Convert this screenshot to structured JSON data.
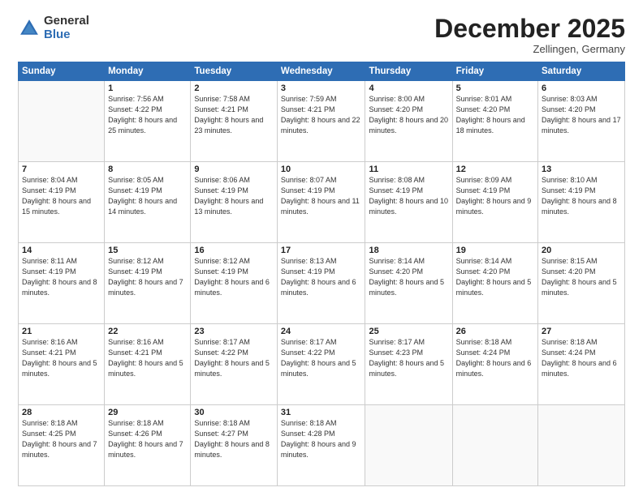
{
  "logo": {
    "general": "General",
    "blue": "Blue"
  },
  "header": {
    "month": "December 2025",
    "location": "Zellingen, Germany"
  },
  "weekdays": [
    "Sunday",
    "Monday",
    "Tuesday",
    "Wednesday",
    "Thursday",
    "Friday",
    "Saturday"
  ],
  "weeks": [
    [
      {
        "day": "",
        "sunrise": "",
        "sunset": "",
        "daylight": ""
      },
      {
        "day": "1",
        "sunrise": "Sunrise: 7:56 AM",
        "sunset": "Sunset: 4:22 PM",
        "daylight": "Daylight: 8 hours and 25 minutes."
      },
      {
        "day": "2",
        "sunrise": "Sunrise: 7:58 AM",
        "sunset": "Sunset: 4:21 PM",
        "daylight": "Daylight: 8 hours and 23 minutes."
      },
      {
        "day": "3",
        "sunrise": "Sunrise: 7:59 AM",
        "sunset": "Sunset: 4:21 PM",
        "daylight": "Daylight: 8 hours and 22 minutes."
      },
      {
        "day": "4",
        "sunrise": "Sunrise: 8:00 AM",
        "sunset": "Sunset: 4:20 PM",
        "daylight": "Daylight: 8 hours and 20 minutes."
      },
      {
        "day": "5",
        "sunrise": "Sunrise: 8:01 AM",
        "sunset": "Sunset: 4:20 PM",
        "daylight": "Daylight: 8 hours and 18 minutes."
      },
      {
        "day": "6",
        "sunrise": "Sunrise: 8:03 AM",
        "sunset": "Sunset: 4:20 PM",
        "daylight": "Daylight: 8 hours and 17 minutes."
      }
    ],
    [
      {
        "day": "7",
        "sunrise": "Sunrise: 8:04 AM",
        "sunset": "Sunset: 4:19 PM",
        "daylight": "Daylight: 8 hours and 15 minutes."
      },
      {
        "day": "8",
        "sunrise": "Sunrise: 8:05 AM",
        "sunset": "Sunset: 4:19 PM",
        "daylight": "Daylight: 8 hours and 14 minutes."
      },
      {
        "day": "9",
        "sunrise": "Sunrise: 8:06 AM",
        "sunset": "Sunset: 4:19 PM",
        "daylight": "Daylight: 8 hours and 13 minutes."
      },
      {
        "day": "10",
        "sunrise": "Sunrise: 8:07 AM",
        "sunset": "Sunset: 4:19 PM",
        "daylight": "Daylight: 8 hours and 11 minutes."
      },
      {
        "day": "11",
        "sunrise": "Sunrise: 8:08 AM",
        "sunset": "Sunset: 4:19 PM",
        "daylight": "Daylight: 8 hours and 10 minutes."
      },
      {
        "day": "12",
        "sunrise": "Sunrise: 8:09 AM",
        "sunset": "Sunset: 4:19 PM",
        "daylight": "Daylight: 8 hours and 9 minutes."
      },
      {
        "day": "13",
        "sunrise": "Sunrise: 8:10 AM",
        "sunset": "Sunset: 4:19 PM",
        "daylight": "Daylight: 8 hours and 8 minutes."
      }
    ],
    [
      {
        "day": "14",
        "sunrise": "Sunrise: 8:11 AM",
        "sunset": "Sunset: 4:19 PM",
        "daylight": "Daylight: 8 hours and 8 minutes."
      },
      {
        "day": "15",
        "sunrise": "Sunrise: 8:12 AM",
        "sunset": "Sunset: 4:19 PM",
        "daylight": "Daylight: 8 hours and 7 minutes."
      },
      {
        "day": "16",
        "sunrise": "Sunrise: 8:12 AM",
        "sunset": "Sunset: 4:19 PM",
        "daylight": "Daylight: 8 hours and 6 minutes."
      },
      {
        "day": "17",
        "sunrise": "Sunrise: 8:13 AM",
        "sunset": "Sunset: 4:19 PM",
        "daylight": "Daylight: 8 hours and 6 minutes."
      },
      {
        "day": "18",
        "sunrise": "Sunrise: 8:14 AM",
        "sunset": "Sunset: 4:20 PM",
        "daylight": "Daylight: 8 hours and 5 minutes."
      },
      {
        "day": "19",
        "sunrise": "Sunrise: 8:14 AM",
        "sunset": "Sunset: 4:20 PM",
        "daylight": "Daylight: 8 hours and 5 minutes."
      },
      {
        "day": "20",
        "sunrise": "Sunrise: 8:15 AM",
        "sunset": "Sunset: 4:20 PM",
        "daylight": "Daylight: 8 hours and 5 minutes."
      }
    ],
    [
      {
        "day": "21",
        "sunrise": "Sunrise: 8:16 AM",
        "sunset": "Sunset: 4:21 PM",
        "daylight": "Daylight: 8 hours and 5 minutes."
      },
      {
        "day": "22",
        "sunrise": "Sunrise: 8:16 AM",
        "sunset": "Sunset: 4:21 PM",
        "daylight": "Daylight: 8 hours and 5 minutes."
      },
      {
        "day": "23",
        "sunrise": "Sunrise: 8:17 AM",
        "sunset": "Sunset: 4:22 PM",
        "daylight": "Daylight: 8 hours and 5 minutes."
      },
      {
        "day": "24",
        "sunrise": "Sunrise: 8:17 AM",
        "sunset": "Sunset: 4:22 PM",
        "daylight": "Daylight: 8 hours and 5 minutes."
      },
      {
        "day": "25",
        "sunrise": "Sunrise: 8:17 AM",
        "sunset": "Sunset: 4:23 PM",
        "daylight": "Daylight: 8 hours and 5 minutes."
      },
      {
        "day": "26",
        "sunrise": "Sunrise: 8:18 AM",
        "sunset": "Sunset: 4:24 PM",
        "daylight": "Daylight: 8 hours and 6 minutes."
      },
      {
        "day": "27",
        "sunrise": "Sunrise: 8:18 AM",
        "sunset": "Sunset: 4:24 PM",
        "daylight": "Daylight: 8 hours and 6 minutes."
      }
    ],
    [
      {
        "day": "28",
        "sunrise": "Sunrise: 8:18 AM",
        "sunset": "Sunset: 4:25 PM",
        "daylight": "Daylight: 8 hours and 7 minutes."
      },
      {
        "day": "29",
        "sunrise": "Sunrise: 8:18 AM",
        "sunset": "Sunset: 4:26 PM",
        "daylight": "Daylight: 8 hours and 7 minutes."
      },
      {
        "day": "30",
        "sunrise": "Sunrise: 8:18 AM",
        "sunset": "Sunset: 4:27 PM",
        "daylight": "Daylight: 8 hours and 8 minutes."
      },
      {
        "day": "31",
        "sunrise": "Sunrise: 8:18 AM",
        "sunset": "Sunset: 4:28 PM",
        "daylight": "Daylight: 8 hours and 9 minutes."
      },
      {
        "day": "",
        "sunrise": "",
        "sunset": "",
        "daylight": ""
      },
      {
        "day": "",
        "sunrise": "",
        "sunset": "",
        "daylight": ""
      },
      {
        "day": "",
        "sunrise": "",
        "sunset": "",
        "daylight": ""
      }
    ]
  ]
}
